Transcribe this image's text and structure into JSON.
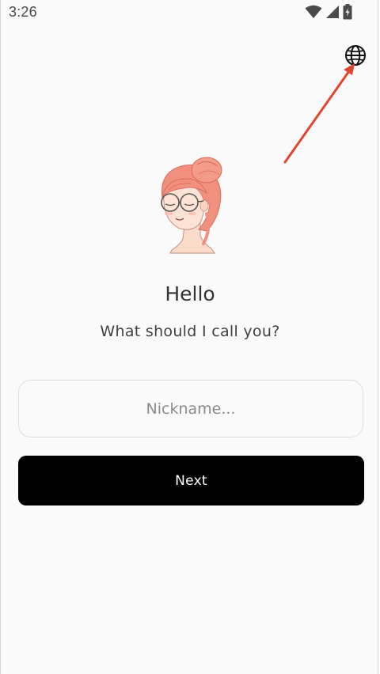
{
  "status_bar": {
    "time": "3:26",
    "icons": [
      "wifi-icon",
      "cellular-signal-icon",
      "battery-charging-icon"
    ]
  },
  "header": {
    "language_icon": "globe-icon"
  },
  "annotation": {
    "color": "#e0452f",
    "points_to": "globe-icon"
  },
  "main": {
    "avatar": "girl-with-glasses-illustration",
    "greeting": "Hello",
    "prompt": "What should I call you?",
    "nickname_input": {
      "placeholder": "Nickname...",
      "value": ""
    },
    "next_label": "Next"
  },
  "colors": {
    "background": "#fafafa",
    "primary_button": "#000000",
    "button_text": "#ffffff",
    "hair": "#f2907f"
  }
}
